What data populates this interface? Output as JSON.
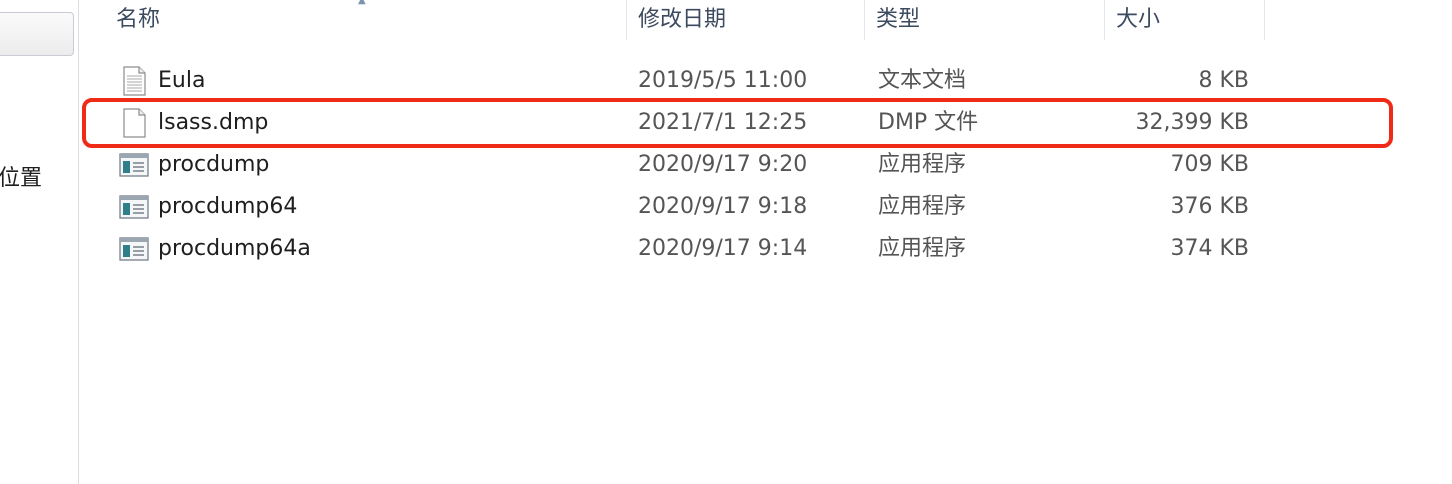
{
  "left_pane": {
    "nav_label": "位置"
  },
  "columns": {
    "name": "名称",
    "date": "修改日期",
    "type": "类型",
    "size": "大小"
  },
  "files": [
    {
      "name": "Eula",
      "date": "2019/5/5 11:00",
      "type": "文本文档",
      "size": "8 KB",
      "icon": "text-document-icon"
    },
    {
      "name": "lsass.dmp",
      "date": "2021/7/1 12:25",
      "type": "DMP 文件",
      "size": "32,399 KB",
      "icon": "blank-file-icon"
    },
    {
      "name": "procdump",
      "date": "2020/9/17 9:20",
      "type": "应用程序",
      "size": "709 KB",
      "icon": "application-icon"
    },
    {
      "name": "procdump64",
      "date": "2020/9/17 9:18",
      "type": "应用程序",
      "size": "376 KB",
      "icon": "application-icon"
    },
    {
      "name": "procdump64a",
      "date": "2020/9/17 9:14",
      "type": "应用程序",
      "size": "374 KB",
      "icon": "application-icon"
    }
  ],
  "highlight": {
    "target": "lsass.dmp",
    "color": "#ef2b18"
  }
}
